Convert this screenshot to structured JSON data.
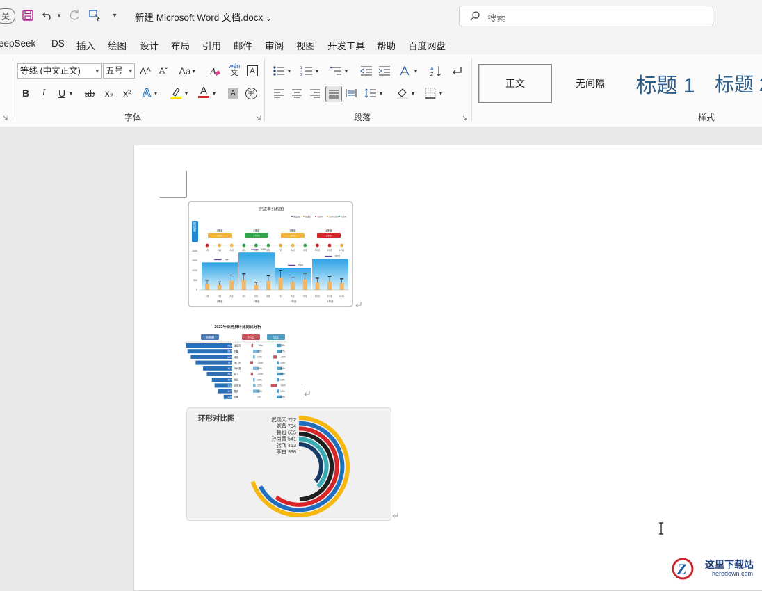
{
  "titlebar": {
    "close_partial": "关",
    "doc_title": "新建 Microsoft Word 文档.docx",
    "search_placeholder": "搜索"
  },
  "menu": [
    "eepSeek",
    "DS",
    "插入",
    "绘图",
    "设计",
    "布局",
    "引用",
    "邮件",
    "审阅",
    "视图",
    "开发工具",
    "帮助",
    "百度网盘"
  ],
  "ribbon": {
    "font_name": "等线 (中文正文)",
    "font_size": "五号",
    "font_group": "字体",
    "para_group": "段落",
    "styles_group": "样式",
    "styles": [
      "正文",
      "无间隔",
      "标题 1",
      "标题 2"
    ],
    "bold": "B",
    "italic": "I",
    "underline": "U",
    "strike": "ab",
    "sub": "x₂",
    "sup": "x²",
    "grow": "A^",
    "shrink": "Aˇ",
    "case": "Aa",
    "phonetic_top": "wén",
    "phonetic_bottom": "文",
    "font_color_letter": "A",
    "highlight_letter": "A"
  },
  "chart1": {
    "title": "完成率分析图",
    "side_label": "完成率",
    "legend": [
      "季度目标",
      "完成率",
      "<100%",
      "100%-120%",
      ">120%"
    ],
    "quarters": [
      "1季度",
      "2季度",
      "3季度",
      "4季度"
    ],
    "quarter_pct": [
      "93%",
      "175%",
      "84%",
      "81%"
    ],
    "months": [
      "1月",
      "2月",
      "3月",
      "4月",
      "5月",
      "6月",
      "7月",
      "8月",
      "9月",
      "10月",
      "11月",
      "12月"
    ],
    "y_ticks": [
      "2000",
      "1500",
      "1000",
      "500",
      "0"
    ],
    "targets": [
      "1447",
      "1959",
      "1164",
      "1622"
    ]
  },
  "chart2": {
    "title": "2023年业务员环比同比分析",
    "headers": [
      "销售额",
      "环比",
      "同比"
    ],
    "names": [
      "诸葛亮",
      "刘备",
      "韩信",
      "狄仁杰",
      "孙尚香",
      "张飞",
      "鲁班",
      "武则天",
      "曹操",
      "貂蝉"
    ],
    "sales": [
      "962",
      "937",
      "869",
      "767",
      "611",
      "532",
      "427",
      "370",
      "307",
      "178"
    ],
    "mom": [
      "-14%",
      "57%",
      "16%",
      "-25%",
      "50%",
      "-20%",
      "15%",
      "22%",
      "58%",
      "1%"
    ],
    "yoy": [
      "38%",
      "47%",
      "-29%",
      "18%",
      "46%",
      "56%",
      "18%",
      "-50%",
      "18%",
      "44%"
    ]
  },
  "chart3": {
    "title": "环形对比图",
    "chart_data": {
      "type": "pie",
      "subtype": "radial-bar",
      "title": "环形对比图",
      "categories": [
        "武则天",
        "刘备",
        "鲁班",
        "孙尚香",
        "张飞",
        "李白"
      ],
      "values": [
        762,
        734,
        655,
        541,
        413,
        398
      ],
      "labels": [
        "武则天 762",
        "刘备 734",
        "鲁班 655",
        "孙尚香 541",
        "张飞 413",
        "李白 398"
      ],
      "colors": [
        "#f6b70f",
        "#1f6fbe",
        "#d7262a",
        "#1e1e1e",
        "#3aaab3",
        "#163a66"
      ],
      "max": 762
    }
  },
  "watermark": {
    "brand": "这里下载站",
    "url": "heredown.com"
  }
}
